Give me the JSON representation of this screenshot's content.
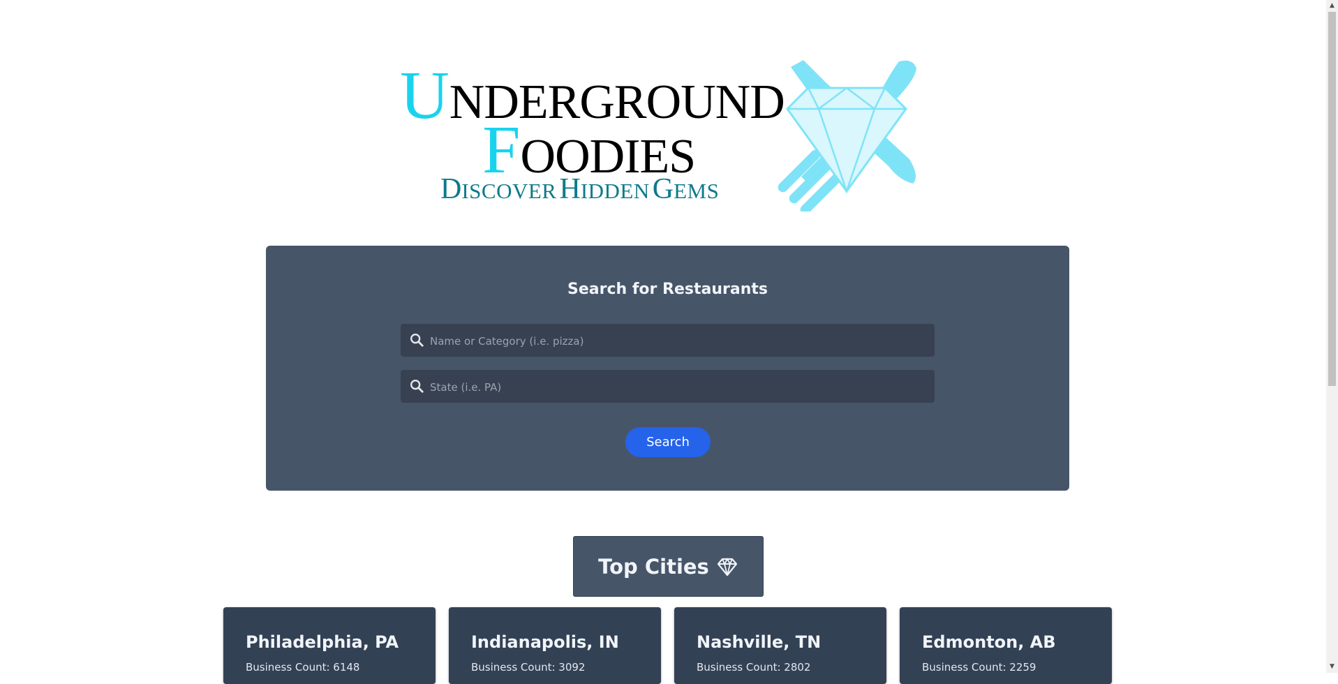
{
  "logo": {
    "line1_initial": "U",
    "line1_rest": "NDERGROUND",
    "line2_initial": "F",
    "line2_rest": "OODIES",
    "tagline_parts": [
      "D",
      "ISCOVER",
      "H",
      "IDDEN",
      "G",
      "EMS"
    ],
    "accent_color": "#19d3ee",
    "tagline_color": "#0e7a8c",
    "gem_icon": "diamond-with-utensils-icon"
  },
  "search": {
    "title": "Search for Restaurants",
    "name_placeholder": "Name or Category (i.e. pizza)",
    "name_value": "",
    "state_placeholder": "State (i.e. PA)",
    "state_value": "",
    "button_label": "Search",
    "button_color": "#2563eb"
  },
  "top_cities": {
    "heading": "Top Cities",
    "heading_icon": "gem-icon",
    "cities": [
      {
        "name": "Philadelphia, PA",
        "count_label": "Business Count: 6148"
      },
      {
        "name": "Indianapolis, IN",
        "count_label": "Business Count: 3092"
      },
      {
        "name": "Nashville, TN",
        "count_label": "Business Count: 2802"
      },
      {
        "name": "Edmonton, AB",
        "count_label": "Business Count: 2259"
      }
    ]
  }
}
